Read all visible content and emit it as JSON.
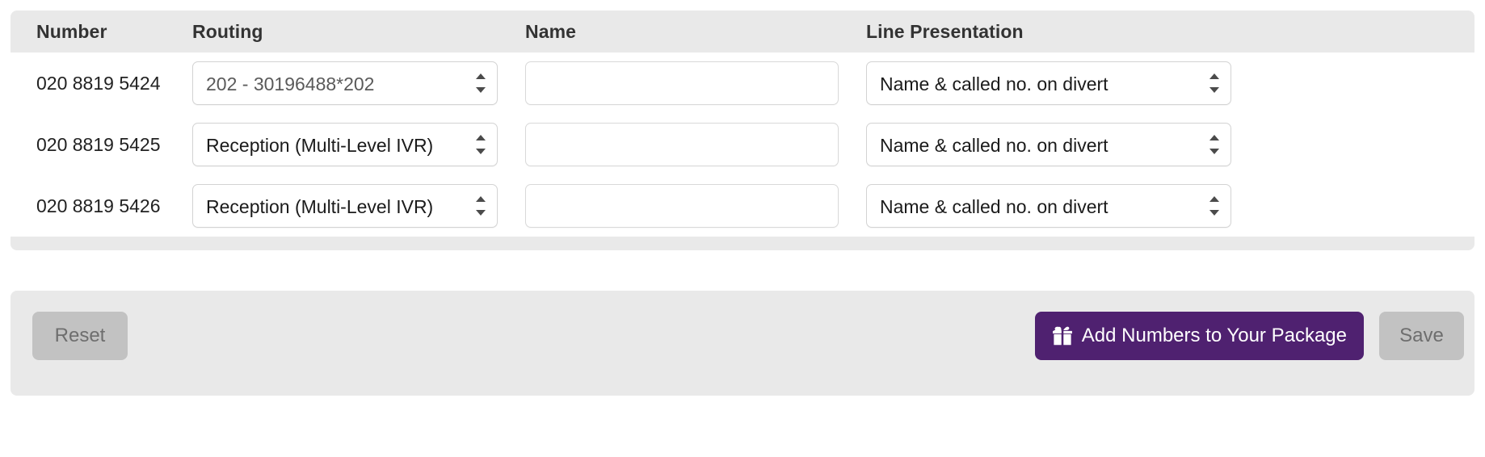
{
  "table": {
    "columns": [
      {
        "key": "number",
        "label": "Number"
      },
      {
        "key": "routing",
        "label": "Routing"
      },
      {
        "key": "name",
        "label": "Name"
      },
      {
        "key": "linepres",
        "label": "Line Presentation"
      }
    ],
    "rows": [
      {
        "number": "020 8819 5424",
        "routing": "202 - 30196488*202",
        "name_value": "",
        "name_placeholder": "",
        "line_presentation": "Name & called no. on divert"
      },
      {
        "number": "020 8819 5425",
        "routing": "Reception (Multi-Level IVR)",
        "name_value": "",
        "name_placeholder": "",
        "line_presentation": "Name & called no. on divert"
      },
      {
        "number": "020 8819 5426",
        "routing": "Reception (Multi-Level IVR)",
        "name_value": "",
        "name_placeholder": "",
        "line_presentation": "Name & called no. on divert"
      }
    ]
  },
  "actions": {
    "reset_label": "Reset",
    "add_numbers_label": "Add Numbers to Your Package",
    "add_numbers_icon": "gift-icon",
    "save_label": "Save"
  },
  "colors": {
    "brand_purple": "#4f2170",
    "panel_grey": "#e9e9e9",
    "disabled_button": "#c2c2c2",
    "disabled_text": "#6e6e6e",
    "field_border": "#d3d3d3",
    "text_primary": "#1b1b1b",
    "text_muted": "#5a5a5a"
  }
}
